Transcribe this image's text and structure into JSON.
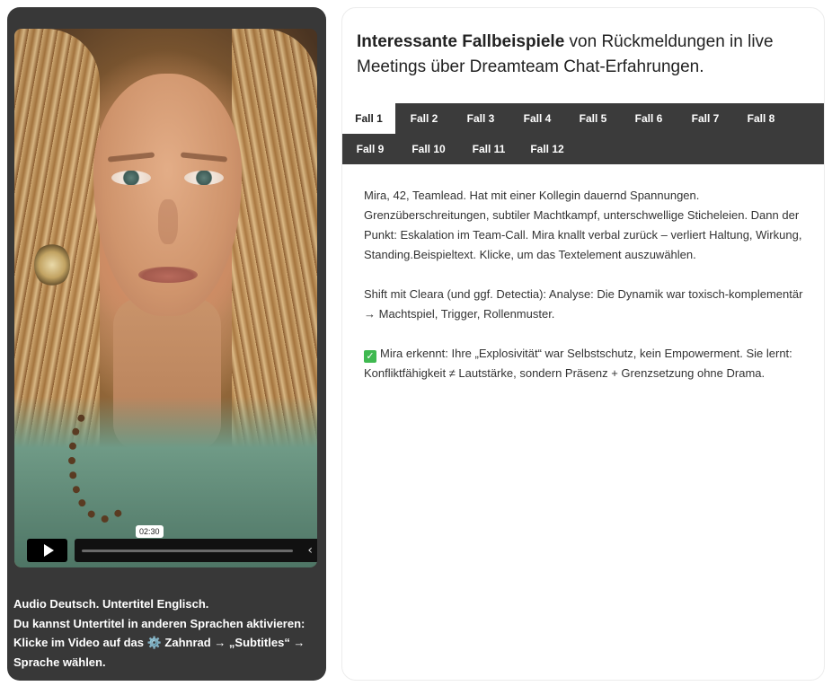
{
  "video": {
    "time_tooltip": "02:30",
    "play_icon": "play-icon",
    "collapse_icon": "chevron-left-icon"
  },
  "left_text": {
    "line1": "Audio Deutsch. Untertitel Englisch.",
    "line2": "Du kannst Untertitel in anderen Sprachen aktivieren:",
    "line3_pre": "Klicke im Video auf das",
    "gear_glyph": "⚙️",
    "line3_post": "Zahnrad → „Subtitles“ →",
    "line4": "Sprache wählen."
  },
  "headline": {
    "bold": "Interessante Fallbeispiele",
    "rest": " von Rückmeldungen in live Meetings über Dreamteam Chat-Erfahrungen."
  },
  "tabs": [
    {
      "label": "Fall 1",
      "active": true
    },
    {
      "label": "Fall 2"
    },
    {
      "label": "Fall 3"
    },
    {
      "label": "Fall 4"
    },
    {
      "label": "Fall 5"
    },
    {
      "label": "Fall 6"
    },
    {
      "label": "Fall 7"
    },
    {
      "label": "Fall 8"
    },
    {
      "label": "Fall 9"
    },
    {
      "label": "Fall 10"
    },
    {
      "label": "Fall 11"
    },
    {
      "label": "Fall 12"
    }
  ],
  "content": {
    "p1": "Mira, 42, Teamlead. Hat mit einer Kollegin dauernd Spannungen. Grenzüberschreitungen, subtiler Machtkampf, unterschwellige Sticheleien. Dann der Punkt: Eskalation im Team-Call. Mira knallt verbal zurück – verliert Haltung, Wirkung, Standing.Beispieltext. Klicke, um das Textelement auszuwählen.",
    "p2": "Shift mit Cleara (und ggf. Detectia): Analyse: Die Dynamik war toxisch-komplementär → Machtspiel, Trigger, Rollenmuster.",
    "check_glyph": "✓",
    "p3": "Mira erkennt: Ihre „Explosivität“ war Selbstschutz, kein Empowerment. Sie lernt: Konfliktfähigkeit ≠ Lautstärke, sondern Präsenz + Grenzsetzung ohne Drama."
  },
  "colors": {
    "left_card_bg": "#383838",
    "tab_bar_bg": "#3b3b3b",
    "check_green": "#3fb950"
  }
}
